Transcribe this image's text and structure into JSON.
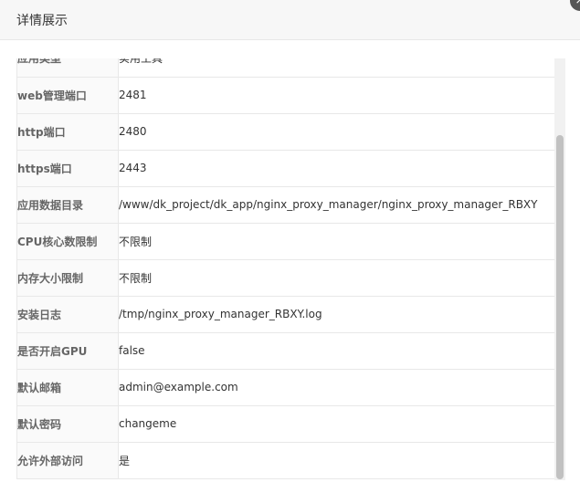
{
  "dialog": {
    "title": "详情展示",
    "close_icon": "×"
  },
  "details": {
    "rows": [
      {
        "label": "应用类型",
        "value": "实用工具"
      },
      {
        "label": "web管理端口",
        "value": "2481"
      },
      {
        "label": "http端口",
        "value": "2480"
      },
      {
        "label": "https端口",
        "value": "2443"
      },
      {
        "label": "应用数据目录",
        "value": "/www/dk_project/dk_app/nginx_proxy_manager/nginx_proxy_manager_RBXY"
      },
      {
        "label": "CPU核心数限制",
        "value": "不限制"
      },
      {
        "label": "内存大小限制",
        "value": "不限制"
      },
      {
        "label": "安装日志",
        "value": "/tmp/nginx_proxy_manager_RBXY.log"
      },
      {
        "label": "是否开启GPU",
        "value": "false"
      },
      {
        "label": "默认邮箱",
        "value": "admin@example.com"
      },
      {
        "label": "默认密码",
        "value": "changeme"
      },
      {
        "label": "允许外部访问",
        "value": "是"
      }
    ]
  },
  "colors": {
    "header_bg": "#f7f7f7",
    "label_bg": "#fafafa",
    "border": "#e8e8e8",
    "scrollbar_thumb": "#c1c1c1"
  }
}
